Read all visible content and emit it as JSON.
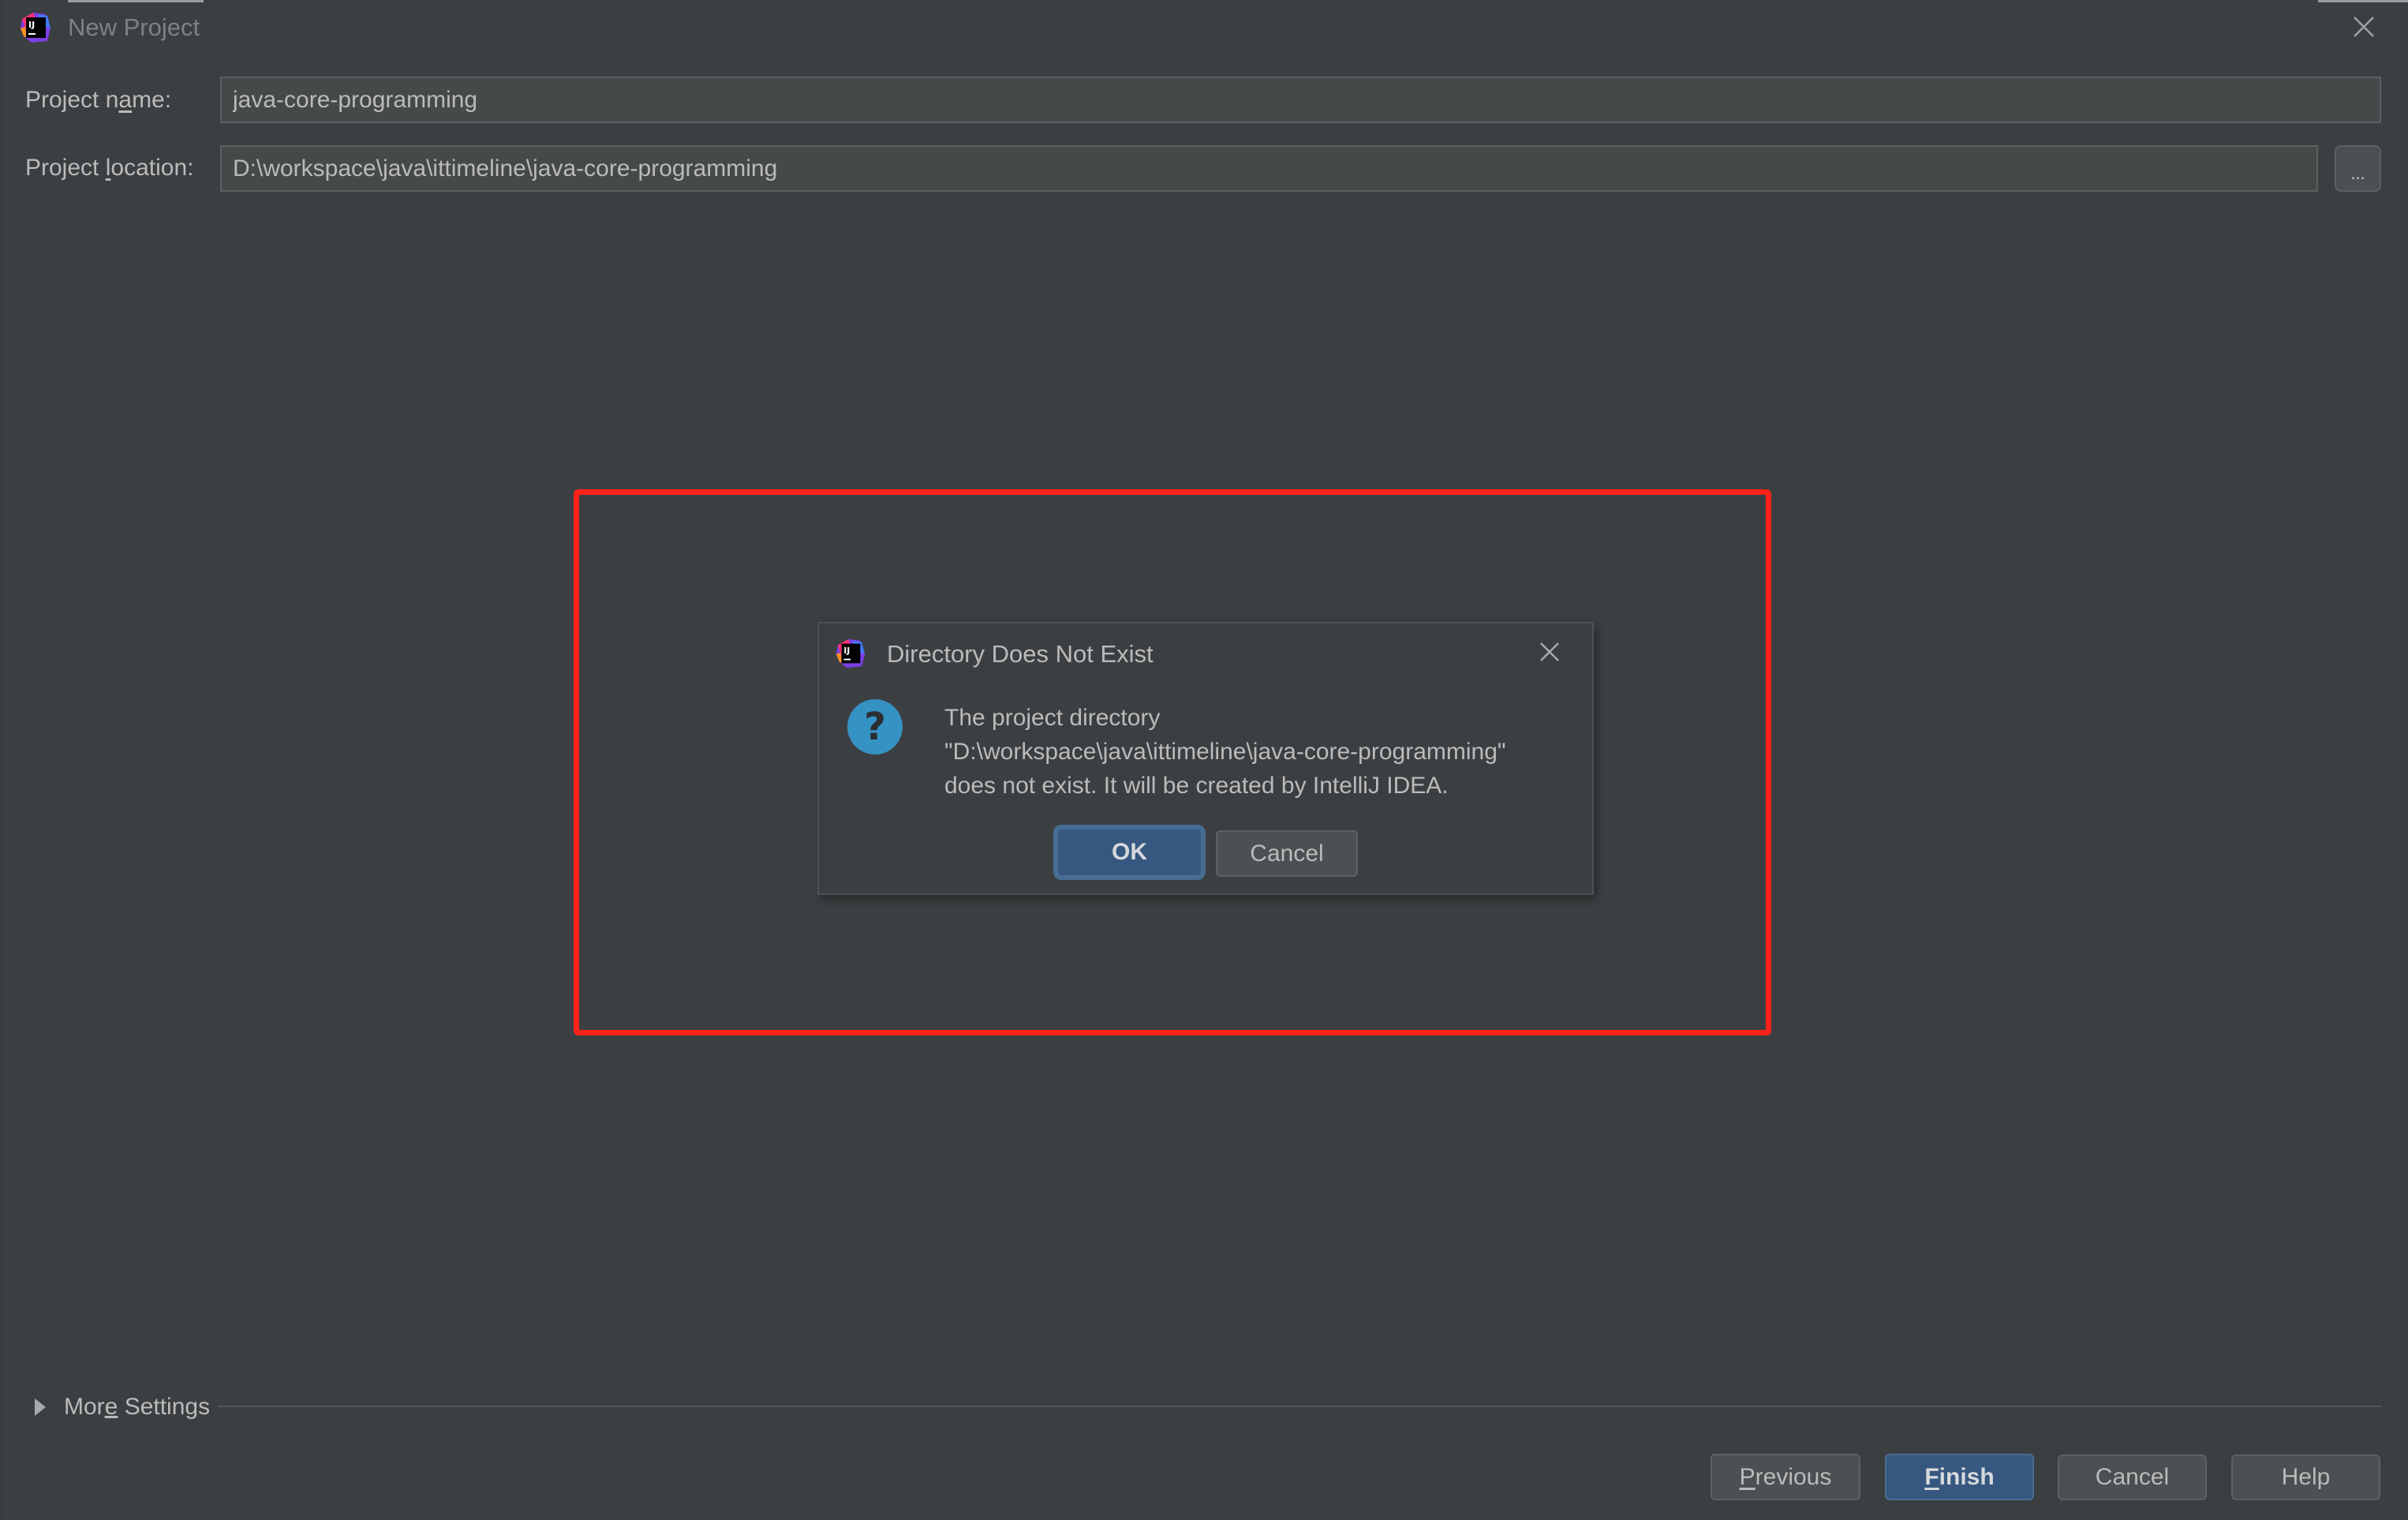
{
  "window": {
    "title": "New Project",
    "app_icon": "intellij-idea-icon",
    "close_icon": "close-icon"
  },
  "form": {
    "project_name": {
      "label_before": "Project n",
      "label_mnemonic": "a",
      "label_after": "me:",
      "value": "java-core-programming"
    },
    "project_location": {
      "label_before": "Project ",
      "label_mnemonic": "l",
      "label_after": "ocation:",
      "value": "D:\\workspace\\java\\ittimeline\\java-core-programming",
      "browse_label": "..."
    }
  },
  "highlight": {
    "color": "#ff2219"
  },
  "dialog": {
    "title": "Directory Does Not Exist",
    "icon": "question-icon",
    "message_lines": [
      "The project directory",
      "\"D:\\workspace\\java\\ittimeline\\java-core-programming\"",
      "does not exist. It will be created by IntelliJ IDEA."
    ],
    "ok_label": "OK",
    "cancel_label": "Cancel"
  },
  "more_settings": {
    "label_before": "Mor",
    "label_mnemonic": "e",
    "label_after": " Settings",
    "expanded": false
  },
  "footer": {
    "previous": {
      "mnemonic": "P",
      "rest": "revious"
    },
    "finish": {
      "mnemonic": "F",
      "rest": "inish"
    },
    "cancel": "Cancel",
    "help": "Help"
  },
  "colors": {
    "background": "#3c3f41",
    "field_background": "#45494a",
    "primary_button": "#365880",
    "text": "#bbbbbb",
    "question_icon": "#3592c4"
  }
}
